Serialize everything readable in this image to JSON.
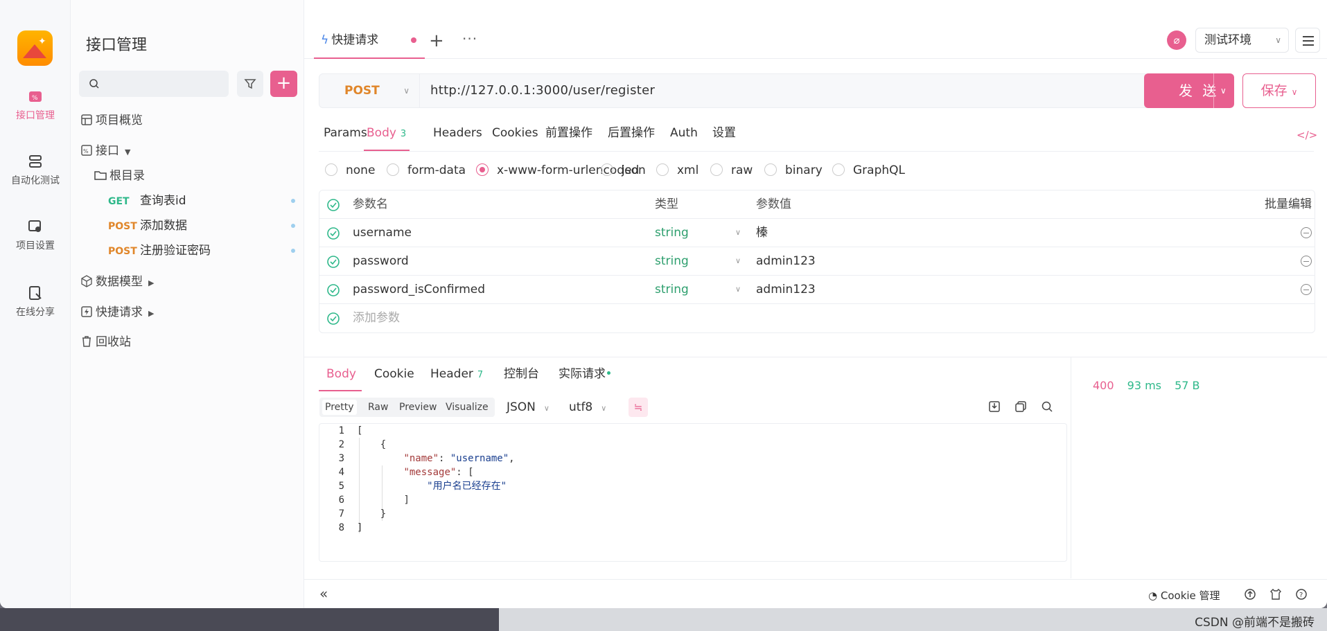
{
  "app": {
    "page_title": "接口管理"
  },
  "rail": [
    {
      "label": "接口管理",
      "icon": "api-icon"
    },
    {
      "label": "自动化测试",
      "icon": "automation-icon"
    },
    {
      "label": "项目设置",
      "icon": "project-settings-icon"
    },
    {
      "label": "在线分享",
      "icon": "share-icon"
    }
  ],
  "sidebar": {
    "search_placeholder": "",
    "tree": {
      "overview": "项目概览",
      "apis": "接口",
      "root": "根目录",
      "endpoints": [
        {
          "method": "GET",
          "name": "查询表id"
        },
        {
          "method": "POST",
          "name": "添加数据"
        },
        {
          "method": "POST",
          "name": "注册验证密码"
        }
      ],
      "models": "数据模型",
      "quick": "快捷请求",
      "trash": "回收站"
    }
  },
  "tabs": {
    "active_tab": "快捷请求"
  },
  "env": {
    "selected": "测试环境"
  },
  "request": {
    "method": "POST",
    "url": "http://127.0.0.1:3000/user/register",
    "send_label": "发 送",
    "save_label": "保存",
    "tabs": [
      {
        "label": "Params"
      },
      {
        "label": "Body",
        "badge": "3"
      },
      {
        "label": "Headers"
      },
      {
        "label": "Cookies"
      },
      {
        "label": "前置操作"
      },
      {
        "label": "后置操作"
      },
      {
        "label": "Auth"
      },
      {
        "label": "设置"
      }
    ],
    "body_types": [
      "none",
      "form-data",
      "x-www-form-urlencoded",
      "json",
      "xml",
      "raw",
      "binary",
      "GraphQL"
    ],
    "selected_body_type": "x-www-form-urlencoded",
    "params_header": {
      "name": "参数名",
      "type": "类型",
      "value": "参数值",
      "batch": "批量编辑"
    },
    "params": [
      {
        "name": "username",
        "type": "string",
        "value": "榛"
      },
      {
        "name": "password",
        "type": "string",
        "value": "admin123"
      },
      {
        "name": "password_isConfirmed",
        "type": "string",
        "value": "admin123"
      }
    ],
    "add_param_placeholder": "添加参数"
  },
  "response": {
    "tabs": [
      {
        "label": "Body"
      },
      {
        "label": "Cookie"
      },
      {
        "label": "Header",
        "badge": "7"
      },
      {
        "label": "控制台"
      },
      {
        "label": "实际请求"
      }
    ],
    "status_code": "400",
    "time": "93 ms",
    "size": "57 B",
    "view_modes": [
      "Pretty",
      "Raw",
      "Preview",
      "Visualize"
    ],
    "format": "JSON",
    "encoding": "utf8",
    "body_lines": [
      "[",
      "    {",
      "        \"name\": \"username\",",
      "        \"message\": [",
      "            \"用户名已经存在\"",
      "        ]",
      "    }",
      "]"
    ],
    "tokens": {
      "l1": "[",
      "l2": "{",
      "l3_key": "\"name\"",
      "l3_val": "\"username\"",
      "l4_key": "\"message\"",
      "l4_rest": ": [",
      "l5_val": "\"用户名已经存在\"",
      "l6": "]",
      "l7": "}",
      "l8": "]"
    }
  },
  "bottom": {
    "cookie_manager": "Cookie 管理"
  },
  "watermark": "CSDN @前端不是搬砖"
}
